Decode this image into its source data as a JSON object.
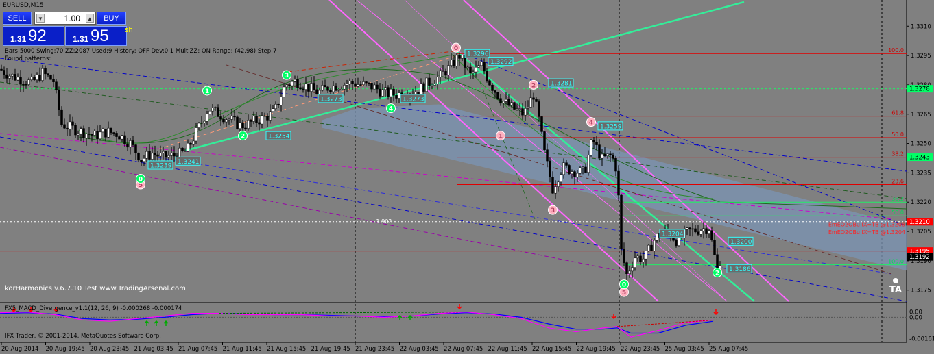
{
  "title": "EURUSD,M15",
  "trade_panel": {
    "sell_label": "SELL",
    "buy_label": "BUY",
    "lot_value": "1.00",
    "bid_prefix": "1.31",
    "bid_big": "92",
    "ask_prefix": "1.31",
    "ask_big": "95",
    "sh_fragment": "sh"
  },
  "indicator_info": "Bars:5000  Swing:70  ZZ:2087  Used:9  History: OFF Dev:0.1  MultiZZ: ON  Range: (42,98)  Step:7",
  "found_patterns": "Found patterns:",
  "watermark": "korHarmonics v.6.7.10 Test www.TradingArsenal.com",
  "macd_label": "FX5_MACD_Divergence_v1.1(12, 26, 9) -0.000268 -0.000174",
  "copyright": "IFX Trader, © 2001-2014, MetaQuotes Software Corp.",
  "logo_text": "TA",
  "colors": {
    "background": "#808080",
    "bull_candle": "#ffffff",
    "bear_candle": "#000000",
    "axis_box_green": "#00ff66",
    "axis_box_red": "#ff0000",
    "pivot_green": "#00ff66",
    "pivot_pink": "#ffb0c0",
    "pattern_band": "#7b94b4",
    "macd_main": "#ff00ff",
    "macd_signal": "#0000ff"
  },
  "chart_data": [
    {
      "type": "candlestick",
      "symbol": "EURUSD",
      "timeframe": "M15",
      "ylim": [
        1.317,
        1.3322
      ],
      "price_axis_ticks": [
        "1.3310",
        "1.3295",
        "1.3280",
        "1.3265",
        "1.3250",
        "1.3235",
        "1.3220",
        "1.3205",
        "1.3190",
        "1.3175"
      ],
      "time_axis_ticks": [
        "20 Aug 2014",
        "20 Aug 19:45",
        "20 Aug 23:45",
        "21 Aug 03:45",
        "21 Aug 07:45",
        "21 Aug 11:45",
        "21 Aug 15:45",
        "21 Aug 19:45",
        "21 Aug 23:45",
        "22 Aug 03:45",
        "22 Aug 07:45",
        "22 Aug 11:45",
        "22 Aug 15:45",
        "22 Aug 19:45",
        "22 Aug 23:45",
        "25 Aug 03:45",
        "25 Aug 07:45"
      ],
      "close_path": [
        [
          0,
          1.3288
        ],
        [
          14,
          1.3285
        ],
        [
          30,
          1.3283
        ],
        [
          46,
          1.3281
        ],
        [
          62,
          1.3286
        ],
        [
          78,
          1.3282
        ],
        [
          90,
          1.326
        ],
        [
          104,
          1.3258
        ],
        [
          120,
          1.3256
        ],
        [
          138,
          1.3254
        ],
        [
          156,
          1.3256
        ],
        [
          172,
          1.3255
        ],
        [
          190,
          1.325
        ],
        [
          206,
          1.3242
        ],
        [
          222,
          1.3245
        ],
        [
          238,
          1.3243
        ],
        [
          256,
          1.3244
        ],
        [
          272,
          1.3246
        ],
        [
          288,
          1.3257
        ],
        [
          304,
          1.3268
        ],
        [
          320,
          1.3265
        ],
        [
          336,
          1.3262
        ],
        [
          352,
          1.3259
        ],
        [
          368,
          1.3261
        ],
        [
          384,
          1.3263
        ],
        [
          400,
          1.3266
        ],
        [
          416,
          1.328
        ],
        [
          432,
          1.3282
        ],
        [
          448,
          1.3279
        ],
        [
          464,
          1.3276
        ],
        [
          480,
          1.3279
        ],
        [
          496,
          1.328
        ],
        [
          512,
          1.3281
        ],
        [
          528,
          1.328
        ],
        [
          544,
          1.3279
        ],
        [
          560,
          1.3276
        ],
        [
          576,
          1.3275
        ],
        [
          592,
          1.3276
        ],
        [
          608,
          1.3277
        ],
        [
          624,
          1.3281
        ],
        [
          640,
          1.3284
        ],
        [
          656,
          1.3289
        ],
        [
          670,
          1.3295
        ],
        [
          686,
          1.3285
        ],
        [
          702,
          1.329
        ],
        [
          716,
          1.328
        ],
        [
          732,
          1.3272
        ],
        [
          748,
          1.3268
        ],
        [
          764,
          1.3265
        ],
        [
          778,
          1.3275
        ],
        [
          786,
          1.3262
        ],
        [
          794,
          1.3245
        ],
        [
          806,
          1.3227
        ],
        [
          820,
          1.3238
        ],
        [
          836,
          1.3236
        ],
        [
          852,
          1.3235
        ],
        [
          864,
          1.3252
        ],
        [
          878,
          1.3242
        ],
        [
          892,
          1.3244
        ],
        [
          900,
          1.3236
        ],
        [
          906,
          1.3195
        ],
        [
          914,
          1.3183
        ],
        [
          926,
          1.3192
        ],
        [
          940,
          1.3191
        ],
        [
          956,
          1.3202
        ],
        [
          972,
          1.3205
        ],
        [
          988,
          1.32
        ],
        [
          1004,
          1.3205
        ],
        [
          1020,
          1.3206
        ],
        [
          1034,
          1.3207
        ],
        [
          1046,
          1.3185
        ],
        [
          1052,
          1.3193
        ]
      ],
      "price_labels": [
        {
          "text": "1.3296",
          "x_bar": 678,
          "price": 1.3296
        },
        {
          "text": "1.3292",
          "x_bar": 712,
          "price": 1.3292
        },
        {
          "text": "1.3281",
          "x_bar": 800,
          "price": 1.3281
        },
        {
          "text": "1.3273",
          "x_bar": 464,
          "price": 1.3273
        },
        {
          "text": "1.3273",
          "x_bar": 584,
          "price": 1.3273
        },
        {
          "text": "1.3259",
          "x_bar": 872,
          "price": 1.3259
        },
        {
          "text": "1.3254",
          "x_bar": 388,
          "price": 1.3254
        },
        {
          "text": "1.3241",
          "x_bar": 256,
          "price": 1.3241
        },
        {
          "text": "1.3239",
          "x_bar": 216,
          "price": 1.3239
        },
        {
          "text": "1.3200",
          "x_bar": 1062,
          "price": 1.32
        },
        {
          "text": "1.3186",
          "x_bar": 1060,
          "price": 1.3186
        },
        {
          "text": "1.3204",
          "x_bar": 962,
          "price": 1.3204
        }
      ],
      "pivots": [
        {
          "label": "0",
          "x_bar": 665,
          "price": 1.3299,
          "color": "pink"
        },
        {
          "label": "1",
          "x_bar": 730,
          "price": 1.3254,
          "color": "pink"
        },
        {
          "label": "2",
          "x_bar": 778,
          "price": 1.328,
          "color": "pink"
        },
        {
          "label": "3",
          "x_bar": 806,
          "price": 1.3216,
          "color": "pink"
        },
        {
          "label": "4",
          "x_bar": 862,
          "price": 1.3261,
          "color": "pink"
        },
        {
          "label": "5",
          "x_bar": 910,
          "price": 1.3174,
          "color": "pink"
        },
        {
          "label": "5",
          "x_bar": 205,
          "price": 1.3229,
          "color": "pink"
        },
        {
          "label": "0",
          "x_bar": 205,
          "price": 1.3232,
          "color": "green"
        },
        {
          "label": "1",
          "x_bar": 302,
          "price": 1.3277,
          "color": "green"
        },
        {
          "label": "2",
          "x_bar": 354,
          "price": 1.3254,
          "color": "green"
        },
        {
          "label": "3",
          "x_bar": 418,
          "price": 1.3285,
          "color": "green"
        },
        {
          "label": "4",
          "x_bar": 570,
          "price": 1.3268,
          "color": "green"
        },
        {
          "label": "0",
          "x_bar": 910,
          "price": 1.3178,
          "color": "green"
        },
        {
          "label": "2",
          "x_bar": 1046,
          "price": 1.3184,
          "color": "green"
        }
      ],
      "fib_levels": [
        {
          "label": "100.0",
          "price": 1.3296
        },
        {
          "label": "61.8",
          "price": 1.3264
        },
        {
          "label": "50.0",
          "price": 1.3253
        },
        {
          "label": "38.2",
          "price": 1.3243
        },
        {
          "label": "23.6",
          "price": 1.3229
        },
        {
          "label": "38.2",
          "price": 1.322
        },
        {
          "label": "50.0",
          "price": 1.3213
        },
        {
          "label": "100.0",
          "price": 1.3188
        }
      ],
      "pattern_annotations": [
        {
          "text": "EmEO2OBu IX=TB   @1.3208",
          "price": 1.3208
        },
        {
          "text": "EmEO2OBu IX=TB   @1.3204",
          "price": 1.3204
        }
      ],
      "horizontal_label": "1.902",
      "axis_boxes": [
        {
          "text": "1.3278",
          "price": 1.3278,
          "color": "green"
        },
        {
          "text": "1.3243",
          "price": 1.3243,
          "color": "green"
        },
        {
          "text": "1.3210",
          "price": 1.321,
          "color": "red"
        },
        {
          "text": "1.3195",
          "price": 1.3195,
          "color": "red"
        },
        {
          "text": "1.3192",
          "price": 1.3192,
          "color": "black"
        }
      ]
    },
    {
      "type": "line",
      "name": "FX5_MACD_Divergence_v1.1(12, 26, 9)",
      "ylim": [
        -0.0018,
        0.0008
      ],
      "axis_ticks": [
        "0.00",
        "0.00",
        "-0.00161"
      ],
      "values_printed": [
        -0.000268,
        -0.000174
      ],
      "main": [
        [
          0,
          0.00035
        ],
        [
          40,
          0.0004
        ],
        [
          80,
          0.0002
        ],
        [
          120,
          -0.0002
        ],
        [
          160,
          -0.0003
        ],
        [
          200,
          -0.0001
        ],
        [
          240,
          0.0001
        ],
        [
          280,
          0.0003
        ],
        [
          320,
          0.0003
        ],
        [
          360,
          0.0002
        ],
        [
          400,
          0.0002
        ],
        [
          440,
          0.0002
        ],
        [
          480,
          0.0001
        ],
        [
          520,
          0.0001
        ],
        [
          560,
          0.0
        ],
        [
          600,
          0.0001
        ],
        [
          640,
          0.0003
        ],
        [
          680,
          0.0004
        ],
        [
          720,
          0.0002
        ],
        [
          760,
          -0.0001
        ],
        [
          800,
          -0.0008
        ],
        [
          840,
          -0.0011
        ],
        [
          880,
          -0.0008
        ],
        [
          900,
          -0.0007
        ],
        [
          920,
          -0.0015
        ],
        [
          960,
          -0.001
        ],
        [
          1000,
          -0.0004
        ],
        [
          1040,
          -0.0002
        ]
      ],
      "signal": [
        [
          0,
          0.0003
        ],
        [
          40,
          0.00035
        ],
        [
          80,
          0.00025
        ],
        [
          120,
          -0.0001
        ],
        [
          160,
          -0.0002
        ],
        [
          200,
          -0.00015
        ],
        [
          240,
          0.0
        ],
        [
          280,
          0.0002
        ],
        [
          320,
          0.0003
        ],
        [
          360,
          0.00025
        ],
        [
          400,
          0.0002
        ],
        [
          440,
          0.0002
        ],
        [
          480,
          0.00015
        ],
        [
          520,
          0.0001
        ],
        [
          560,
          5e-05
        ],
        [
          600,
          0.0001
        ],
        [
          640,
          0.00025
        ],
        [
          680,
          0.00035
        ],
        [
          720,
          0.00025
        ],
        [
          760,
          0.0
        ],
        [
          800,
          -0.0005
        ],
        [
          840,
          -0.0009
        ],
        [
          880,
          -0.0009
        ],
        [
          900,
          -0.0008
        ],
        [
          920,
          -0.0012
        ],
        [
          960,
          -0.0012
        ],
        [
          1000,
          -0.0006
        ],
        [
          1040,
          -0.0003
        ]
      ]
    }
  ]
}
